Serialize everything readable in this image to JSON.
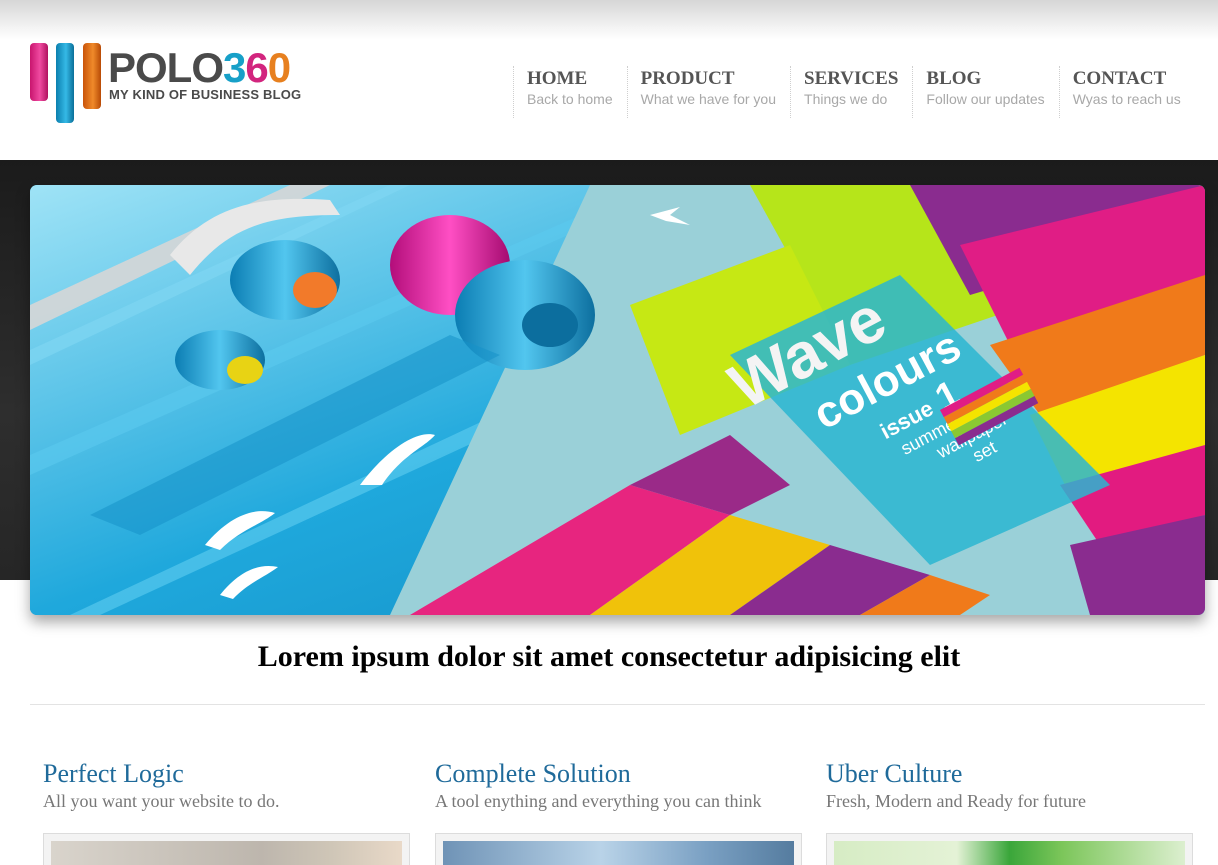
{
  "logo": {
    "word_a": "POLO",
    "n3": "3",
    "n6": "6",
    "n0": "0",
    "tagline": "MY KIND OF BUSINESS BLOG"
  },
  "nav": [
    {
      "title": "HOME",
      "subtitle": "Back to home"
    },
    {
      "title": "PRODUCT",
      "subtitle": "What we have for you"
    },
    {
      "title": "SERVICES",
      "subtitle": "Things we do"
    },
    {
      "title": "BLOG",
      "subtitle": "Follow our updates"
    },
    {
      "title": "CONTACT",
      "subtitle": "Wyas to reach us"
    }
  ],
  "banner": {
    "text_wave": "Wave",
    "text_colours": "colours",
    "text_issue": "issue",
    "text_issue_number": "1",
    "text_summer": "summer",
    "text_wallpaper": "wallpaper",
    "text_set": "set"
  },
  "tagline": "Lorem ipsum dolor sit amet consectetur adipisicing elit",
  "features": [
    {
      "title": "Perfect Logic",
      "subtitle": "All you want your website to do."
    },
    {
      "title": "Complete Solution",
      "subtitle": "A tool enything and everything you can think"
    },
    {
      "title": "Uber Culture",
      "subtitle": "Fresh, Modern and Ready for future"
    }
  ],
  "colors": {
    "accent_blue": "#1f6a9a",
    "logo_pink": "#d2257e",
    "logo_blue": "#17a0c8",
    "logo_orange": "#e7801f"
  }
}
